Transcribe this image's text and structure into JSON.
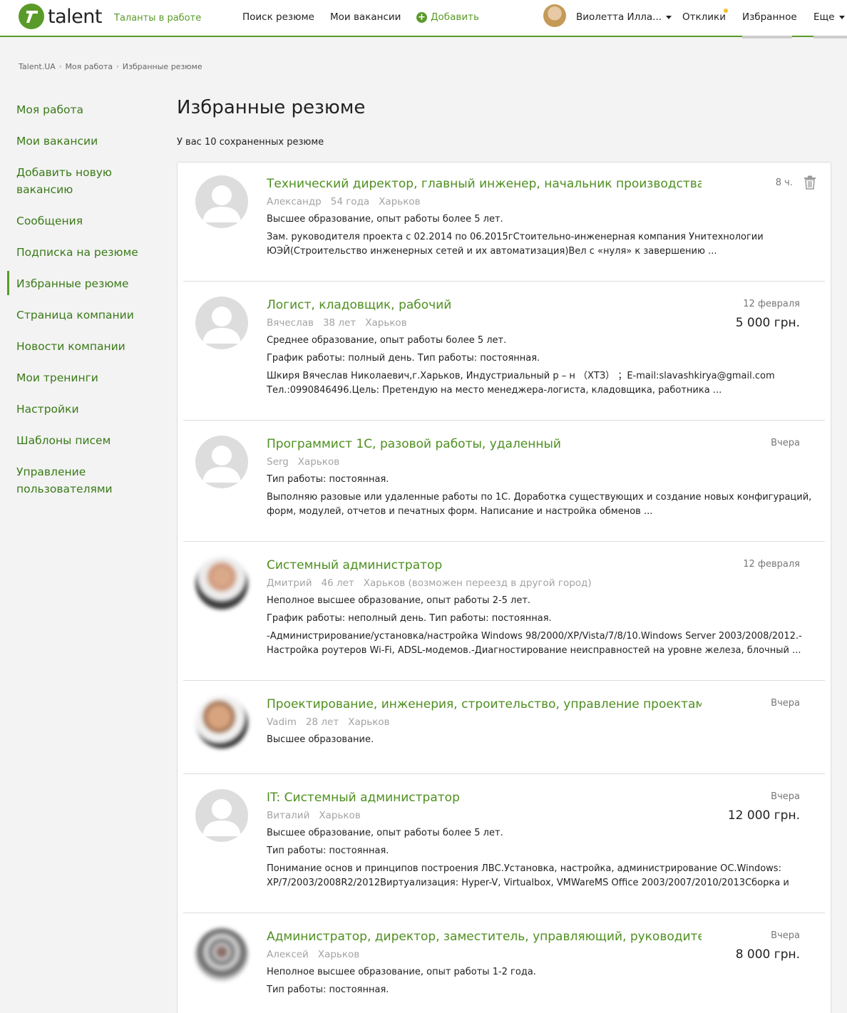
{
  "header": {
    "logo_text": "talent",
    "tagline": "Таланты в работе",
    "nav": {
      "search": "Поиск резюме",
      "vacancies": "Мои вакансии",
      "add": "Добавить",
      "user_name": "Виолетта Илла...",
      "responses": "Отклики",
      "favorites": "Избранное",
      "more": "Еще"
    }
  },
  "breadcrumb": [
    "Talent.UA",
    "Моя работа",
    "Избранные резюме"
  ],
  "sidebar": {
    "items": [
      {
        "label": "Моя работа"
      },
      {
        "label": "Мои вакансии"
      },
      {
        "label": "Добавить новую вакансию"
      },
      {
        "label": "Сообщения"
      },
      {
        "label": "Подписка на резюме"
      },
      {
        "label": "Избранные резюме",
        "active": true
      },
      {
        "label": "Страница компании"
      },
      {
        "label": "Новости компании"
      },
      {
        "label": "Мои тренинги"
      },
      {
        "label": "Настройки"
      },
      {
        "label": "Шаблоны писем"
      },
      {
        "label": "Управление пользователями"
      }
    ]
  },
  "main": {
    "title": "Избранные резюме",
    "count_text": "У вас 10 сохраненных резюме"
  },
  "resumes": [
    {
      "title": "Технический директор, главный инженер, начальник производства",
      "name": "Александр",
      "age": "54 года",
      "city": "Харьков",
      "date": "8 ч.",
      "salary": "",
      "lines": [
        "Высшее образование, опыт работы более 5 лет.",
        "Зам. руководителя проекта с 02.2014 по 06.2015гСтоительно-инженерная компания Унитехнологии ЮЭЙ(Строительство инженерных сетей и их автоматизация)Вел с «нуля» к завершению ..."
      ]
    },
    {
      "title": "Логист, кладовщик, рабочий",
      "name": "Вячеслав",
      "age": "38 лет",
      "city": "Харьков",
      "date": "12 февраля",
      "salary": "5 000 грн.",
      "lines": [
        "Среднее образование, опыт работы более 5 лет.",
        "График работы: полный день. Тип работы: постоянная.",
        "Шкиря Вячеслав Николаевич,г.Харьков, Индустриальный р – н （ХТЗ） ；E-mail:slavashkirya@gmail.com Тел.:0990846496.Цель: Претендую на место менеджера-логиста, кладовщика, работника ..."
      ]
    },
    {
      "title": "Программист 1С, разовой работы, удаленный",
      "name": "Serg",
      "age": "",
      "city": "Харьков",
      "date": "Вчера",
      "salary": "",
      "lines": [
        "Тип работы: постоянная.",
        "Выполняю разовые или удаленные работы по 1С. Доработка существующих и создание новых конфигураций, форм, модулей, отчетов и печатных форм. Написание и настройка обменов ..."
      ]
    },
    {
      "title": "Системный администратор",
      "name": "Дмитрий",
      "age": "46 лет",
      "city": "Харьков (возможен переезд в другой город)",
      "date": "12 февраля",
      "salary": "",
      "lines": [
        "Неполное высшее образование, опыт работы 2-5 лет.",
        "График работы: неполный день. Тип работы: постоянная.",
        "-Администрирование/установка/настройка Windows 98/2000/XP/Vista/7/8/10.Windows Server 2003/2008/2012.-Настройка роутеров Wi-Fi, ADSL-модемов.-Диагностирование неисправностей на уровне железа, блочный ..."
      ]
    },
    {
      "title": "Проектирование, инженерия, строительство, управление проектами",
      "name": "Vadim",
      "age": "28 лет",
      "city": "Харьков",
      "date": "Вчера",
      "salary": "",
      "lines": [
        "Высшее образование."
      ]
    },
    {
      "title": "IT: Системный администратор",
      "name": "Виталий",
      "age": "",
      "city": "Харьков",
      "date": "Вчера",
      "salary": "12 000 грн.",
      "lines": [
        "Высшее образование, опыт работы более 5 лет.",
        "Тип работы: постоянная.",
        "Понимание основ и принципов построения ЛВС.Установка, настройка, администрирование ОС.Windows: XP/7/2003/2008R2/2012Виртуализация: Hyper-V, Virtualbox, VMWareMS Office 2003/2007/2010/2013Сборка и"
      ]
    },
    {
      "title": "Администратор, директор, заместитель, управляющий, руководитель,",
      "name": "Алексей",
      "age": "",
      "city": "Харьков",
      "date": "Вчера",
      "salary": "8 000 грн.",
      "lines": [
        "Неполное высшее образование, опыт работы 1-2 года.",
        "Тип работы: постоянная."
      ]
    }
  ],
  "colors": {
    "accent": "#5a9a29",
    "link": "#4e8f1f",
    "notif": "#f2c12e"
  }
}
